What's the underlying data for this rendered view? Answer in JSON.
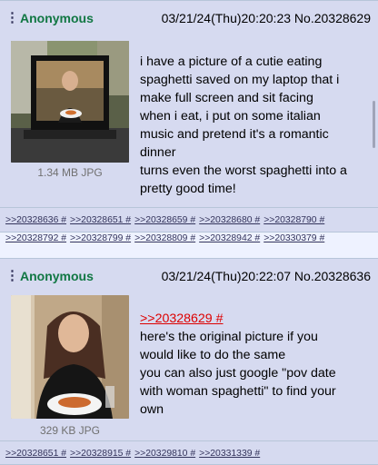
{
  "posts": [
    {
      "name": "Anonymous",
      "datetime": "03/21/24(Thu)20:20:23",
      "post_no": "No.20328629",
      "file_info": "1.34 MB JPG",
      "message_lines": [
        "i have a picture of a cutie eating",
        "spaghetti saved on my laptop that i",
        "make full screen and sit facing",
        "when i eat, i put on some italian",
        "music and pretend it's a romantic",
        "dinner",
        "turns even the worst spaghetti into a",
        "pretty good time!"
      ],
      "replies": [
        ">>20328636 #",
        ">>20328651 #",
        ">>20328659 #",
        ">>20328680 #",
        ">>20328790 #",
        ">>20328792 #",
        ">>20328799 #",
        ">>20328809 #",
        ">>20328942 #",
        ">>20330379 #"
      ]
    },
    {
      "name": "Anonymous",
      "datetime": "03/21/24(Thu)20:22:07",
      "post_no": "No.20328636",
      "file_info": "329 KB JPG",
      "quote": ">>20328629 #",
      "message_lines": [
        "here's the original picture if you",
        "would like to do the same",
        "you can also just google \"pov date",
        "with woman spaghetti\" to find your",
        "own"
      ],
      "replies": [
        ">>20328651 #",
        ">>20328915 #",
        ">>20329810 #",
        ">>20331339 #"
      ]
    }
  ],
  "icons": {
    "menu": "post-menu-icon"
  },
  "colors": {
    "name": "#117743",
    "quote": "#dd0000",
    "post_bg": "#d6daf0",
    "page_bg": "#eef2ff"
  }
}
